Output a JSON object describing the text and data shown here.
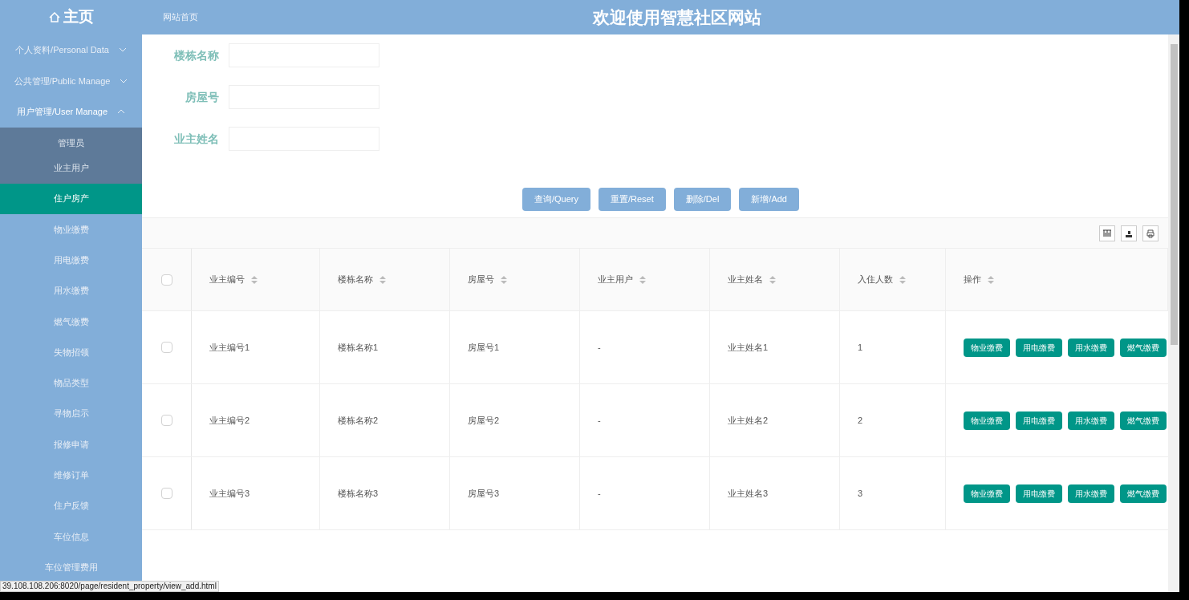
{
  "header": {
    "logo": "主页",
    "breadcrumb": "网站首页",
    "title": "欢迎使用智慧社区网站"
  },
  "sidebar": {
    "items": [
      {
        "label": "个人资料/Personal Data",
        "expanded": false
      },
      {
        "label": "公共管理/Public Manage",
        "expanded": false
      },
      {
        "label": "用户管理/User Manage",
        "expanded": true,
        "children": [
          {
            "label": "管理员",
            "selected": false
          },
          {
            "label": "业主用户",
            "selected": false
          }
        ]
      },
      {
        "label": "住户房产",
        "selected": true
      },
      {
        "label": "物业缴费",
        "selected": false
      },
      {
        "label": "用电缴费",
        "selected": false
      },
      {
        "label": "用水缴费",
        "selected": false
      },
      {
        "label": "燃气缴费",
        "selected": false
      },
      {
        "label": "失物招领",
        "selected": false
      },
      {
        "label": "物品类型",
        "selected": false
      },
      {
        "label": "寻物启示",
        "selected": false
      },
      {
        "label": "报修申请",
        "selected": false
      },
      {
        "label": "维修订单",
        "selected": false
      },
      {
        "label": "住户反馈",
        "selected": false
      },
      {
        "label": "车位信息",
        "selected": false
      },
      {
        "label": "车位管理费用",
        "selected": false
      }
    ]
  },
  "search": {
    "fields": [
      {
        "label": "楼栋名称"
      },
      {
        "label": "房屋号"
      },
      {
        "label": "业主姓名"
      }
    ],
    "buttons": [
      "查询/Query",
      "重置/Reset",
      "删除/Del",
      "新增/Add"
    ]
  },
  "table": {
    "columns": [
      "业主编号",
      "楼栋名称",
      "房屋号",
      "业主用户",
      "业主姓名",
      "入住人数",
      "操作"
    ],
    "rows": [
      {
        "checked": false,
        "cells": [
          "业主编号1",
          "楼栋名称1",
          "房屋号1",
          "-",
          "业主姓名1",
          "1"
        ],
        "actions": [
          "物业缴费",
          "用电缴费",
          "用水缴费",
          "燃气缴费"
        ]
      },
      {
        "checked": false,
        "cells": [
          "业主编号2",
          "楼栋名称2",
          "房屋号2",
          "-",
          "业主姓名2",
          "2"
        ],
        "actions": [
          "物业缴费",
          "用电缴费",
          "用水缴费",
          "燃气缴费"
        ]
      },
      {
        "checked": false,
        "cells": [
          "业主编号3",
          "楼栋名称3",
          "房屋号3",
          "-",
          "业主姓名3",
          "3"
        ],
        "actions": [
          "物业缴费",
          "用电缴费",
          "用水缴费",
          "燃气缴费"
        ]
      }
    ],
    "all_checked": false
  },
  "status_bar": "39.108.108.206:8020/page/resident_property/view_add.html"
}
